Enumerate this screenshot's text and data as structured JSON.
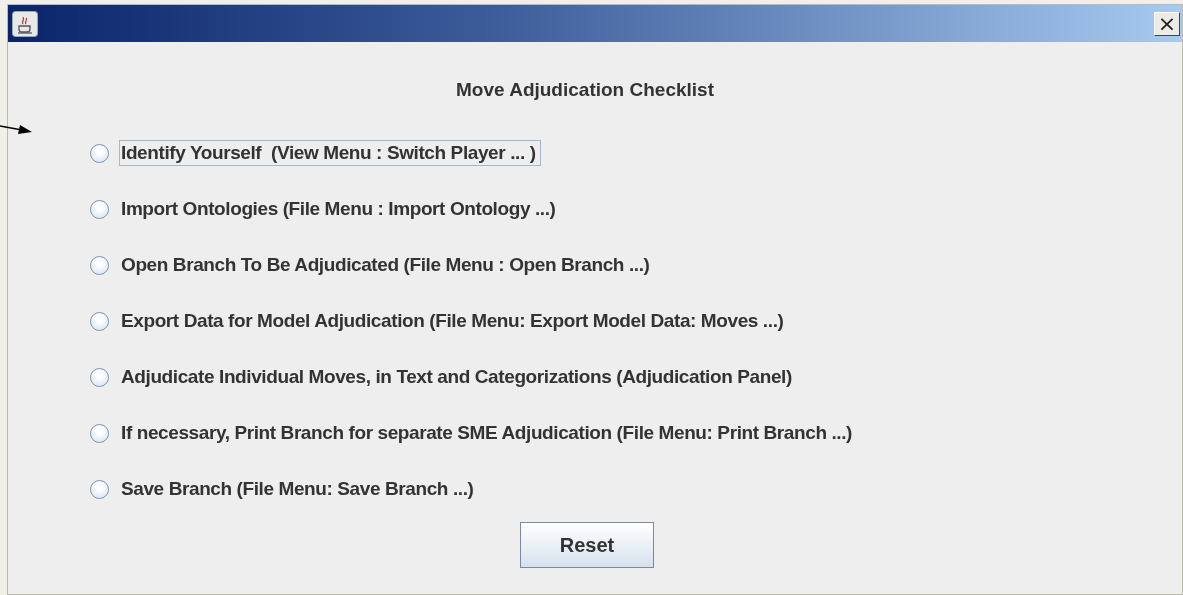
{
  "window": {
    "close": "×"
  },
  "heading": "Move Adjudication Checklist",
  "items": [
    {
      "label": "Identify Yourself  (View Menu : Switch Player ... )",
      "checked": false,
      "focused": true
    },
    {
      "label": "Import Ontologies (File Menu : Import Ontology ...)",
      "checked": false,
      "focused": false
    },
    {
      "label": "Open Branch To Be Adjudicated (File Menu : Open Branch ...)",
      "checked": false,
      "focused": false
    },
    {
      "label": "Export Data for Model Adjudication (File Menu: Export Model Data: Moves ...)",
      "checked": false,
      "focused": false
    },
    {
      "label": "Adjudicate Individual Moves, in Text and Categorizations (Adjudication Panel)",
      "checked": false,
      "focused": false
    },
    {
      "label": "If necessary, Print Branch for separate SME Adjudication (File Menu: Print Branch ...)",
      "checked": false,
      "focused": false
    },
    {
      "label": "Save Branch (File Menu: Save Branch ...)",
      "checked": false,
      "focused": false
    }
  ],
  "button": "Reset"
}
